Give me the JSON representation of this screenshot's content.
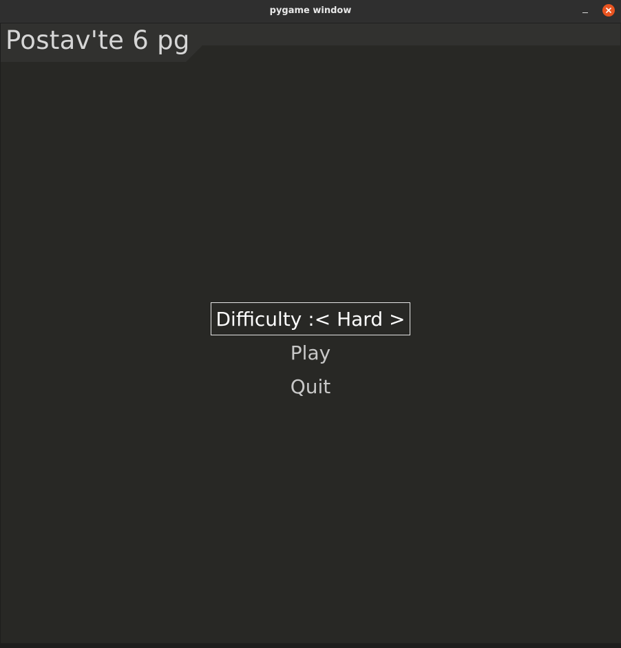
{
  "window": {
    "title": "pygame window",
    "minimize_icon": "minimize-icon",
    "close_icon": "close-icon",
    "close_color": "#e95420"
  },
  "header": {
    "text": "Postav'te 6 pg"
  },
  "menu": {
    "difficulty": {
      "label": "Difficulty :",
      "left_arrow": "<",
      "value": "Hard",
      "right_arrow": ">"
    },
    "play_label": "Play",
    "quit_label": "Quit",
    "selected_item": "difficulty"
  },
  "colors": {
    "background": "#282825",
    "header_band": "#31312f",
    "text": "#c8c8c8",
    "selected_text": "#ffffff"
  }
}
